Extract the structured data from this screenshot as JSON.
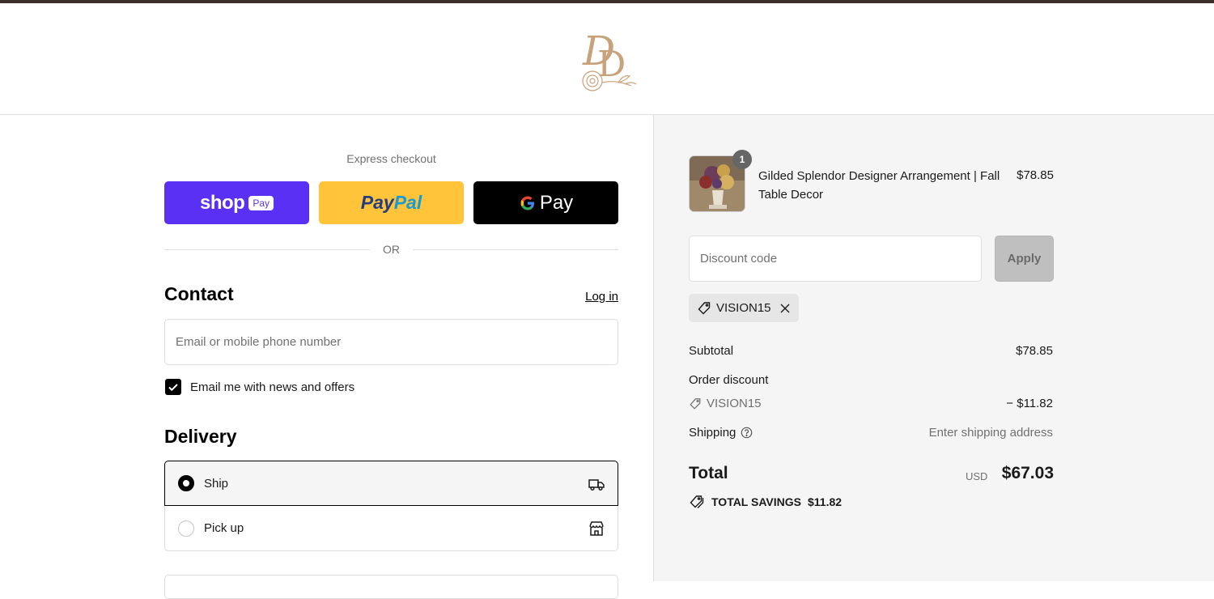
{
  "brand": {
    "logo_text": "DD"
  },
  "express": {
    "label": "Express checkout",
    "shop_pay": {
      "word": "shop",
      "pill": "Pay"
    },
    "paypal": {
      "part1": "Pay",
      "part2": "Pal"
    },
    "gpay": {
      "g": "G",
      "word": "Pay"
    },
    "or_text": "OR"
  },
  "contact": {
    "heading": "Contact",
    "login_label": "Log in",
    "email_placeholder": "Email or mobile phone number",
    "newsletter_label": "Email me with news and offers",
    "newsletter_checked": true
  },
  "delivery": {
    "heading": "Delivery",
    "options": [
      {
        "label": "Ship",
        "selected": true,
        "icon": "truck-icon"
      },
      {
        "label": "Pick up",
        "selected": false,
        "icon": "store-icon"
      }
    ]
  },
  "summary": {
    "item": {
      "quantity": "1",
      "name": "Gilded Splendor Designer Arrangement | Fall Table Decor",
      "price": "$78.85"
    },
    "discount": {
      "placeholder": "Discount code",
      "apply_label": "Apply",
      "applied_code": "VISION15"
    },
    "subtotal_label": "Subtotal",
    "subtotal_value": "$78.85",
    "order_discount_label": "Order discount",
    "order_discount_code": "VISION15",
    "order_discount_value": "− $11.82",
    "shipping_label": "Shipping",
    "shipping_value": "Enter shipping address",
    "total_label": "Total",
    "currency": "USD",
    "total_value": "$67.03",
    "savings_label": "TOTAL SAVINGS",
    "savings_value": "$11.82"
  },
  "colors": {
    "shop_pay": "#5a31f4",
    "paypal": "#ffc439",
    "gpay": "#000000",
    "logo_gold": "#c8a27a",
    "summary_bg": "#f5f5f5"
  }
}
